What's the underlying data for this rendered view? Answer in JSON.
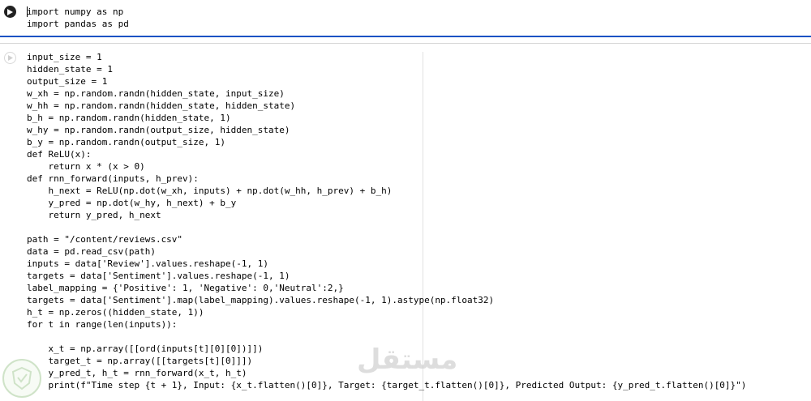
{
  "cells": [
    {
      "lines": [
        "import numpy as np",
        "import pandas as pd"
      ]
    },
    {
      "lines": [
        "input_size = 1",
        "hidden_state = 1",
        "output_size = 1",
        "w_xh = np.random.randn(hidden_state, input_size)",
        "w_hh = np.random.randn(hidden_state, hidden_state)",
        "b_h = np.random.randn(hidden_state, 1)",
        "w_hy = np.random.randn(output_size, hidden_state)",
        "b_y = np.random.randn(output_size, 1)",
        "def ReLU(x):",
        "    return x * (x > 0)",
        "def rnn_forward(inputs, h_prev):",
        "    h_next = ReLU(np.dot(w_xh, inputs) + np.dot(w_hh, h_prev) + b_h)",
        "    y_pred = np.dot(w_hy, h_next) + b_y",
        "    return y_pred, h_next",
        "",
        "path = \"/content/reviews.csv\"",
        "data = pd.read_csv(path)",
        "inputs = data['Review'].values.reshape(-1, 1)",
        "targets = data['Sentiment'].values.reshape(-1, 1)",
        "label_mapping = {'Positive': 1, 'Negative': 0,'Neutral':2,}",
        "targets = data['Sentiment'].map(label_mapping).values.reshape(-1, 1).astype(np.float32)",
        "h_t = np.zeros((hidden_state, 1))",
        "for t in range(len(inputs)):",
        "",
        "    x_t = np.array([[ord(inputs[t][0][0])]])",
        "    target_t = np.array([[targets[t][0]]])",
        "    y_pred_t, h_t = rnn_forward(x_t, h_t)",
        "    print(f\"Time step {t + 1}, Input: {x_t.flatten()[0]}, Target: {target_t.flatten()[0]}, Predicted Output: {y_pred_t.flatten()[0]}\")"
      ]
    }
  ],
  "watermark": "مستقل"
}
